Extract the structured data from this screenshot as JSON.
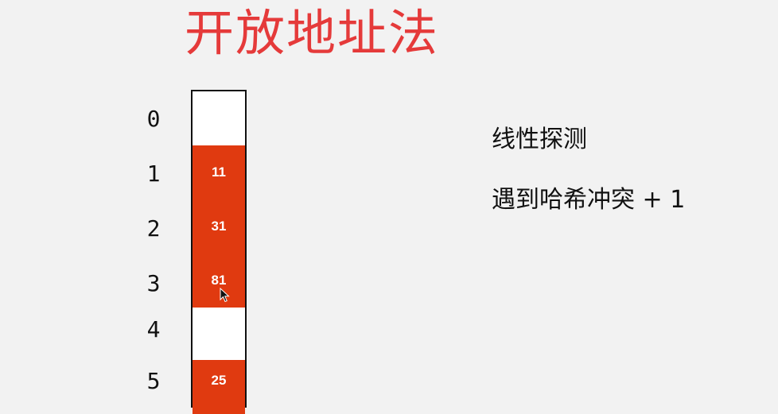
{
  "title": "开放地址法",
  "indices": [
    "0",
    "1",
    "2",
    "3",
    "4",
    "5"
  ],
  "cells": [
    {
      "value": "",
      "filled": false
    },
    {
      "value": "11",
      "filled": true
    },
    {
      "value": "31",
      "filled": true
    },
    {
      "value": "81",
      "filled": true
    },
    {
      "value": "",
      "filled": false
    },
    {
      "value": "25",
      "filled": true
    }
  ],
  "notes": {
    "line1": "线性探测",
    "line2": "遇到哈希冲突 + 1"
  },
  "colors": {
    "title": "#e53a3a",
    "filled_cell": "#e03a10",
    "background": "#f2f2f2"
  }
}
